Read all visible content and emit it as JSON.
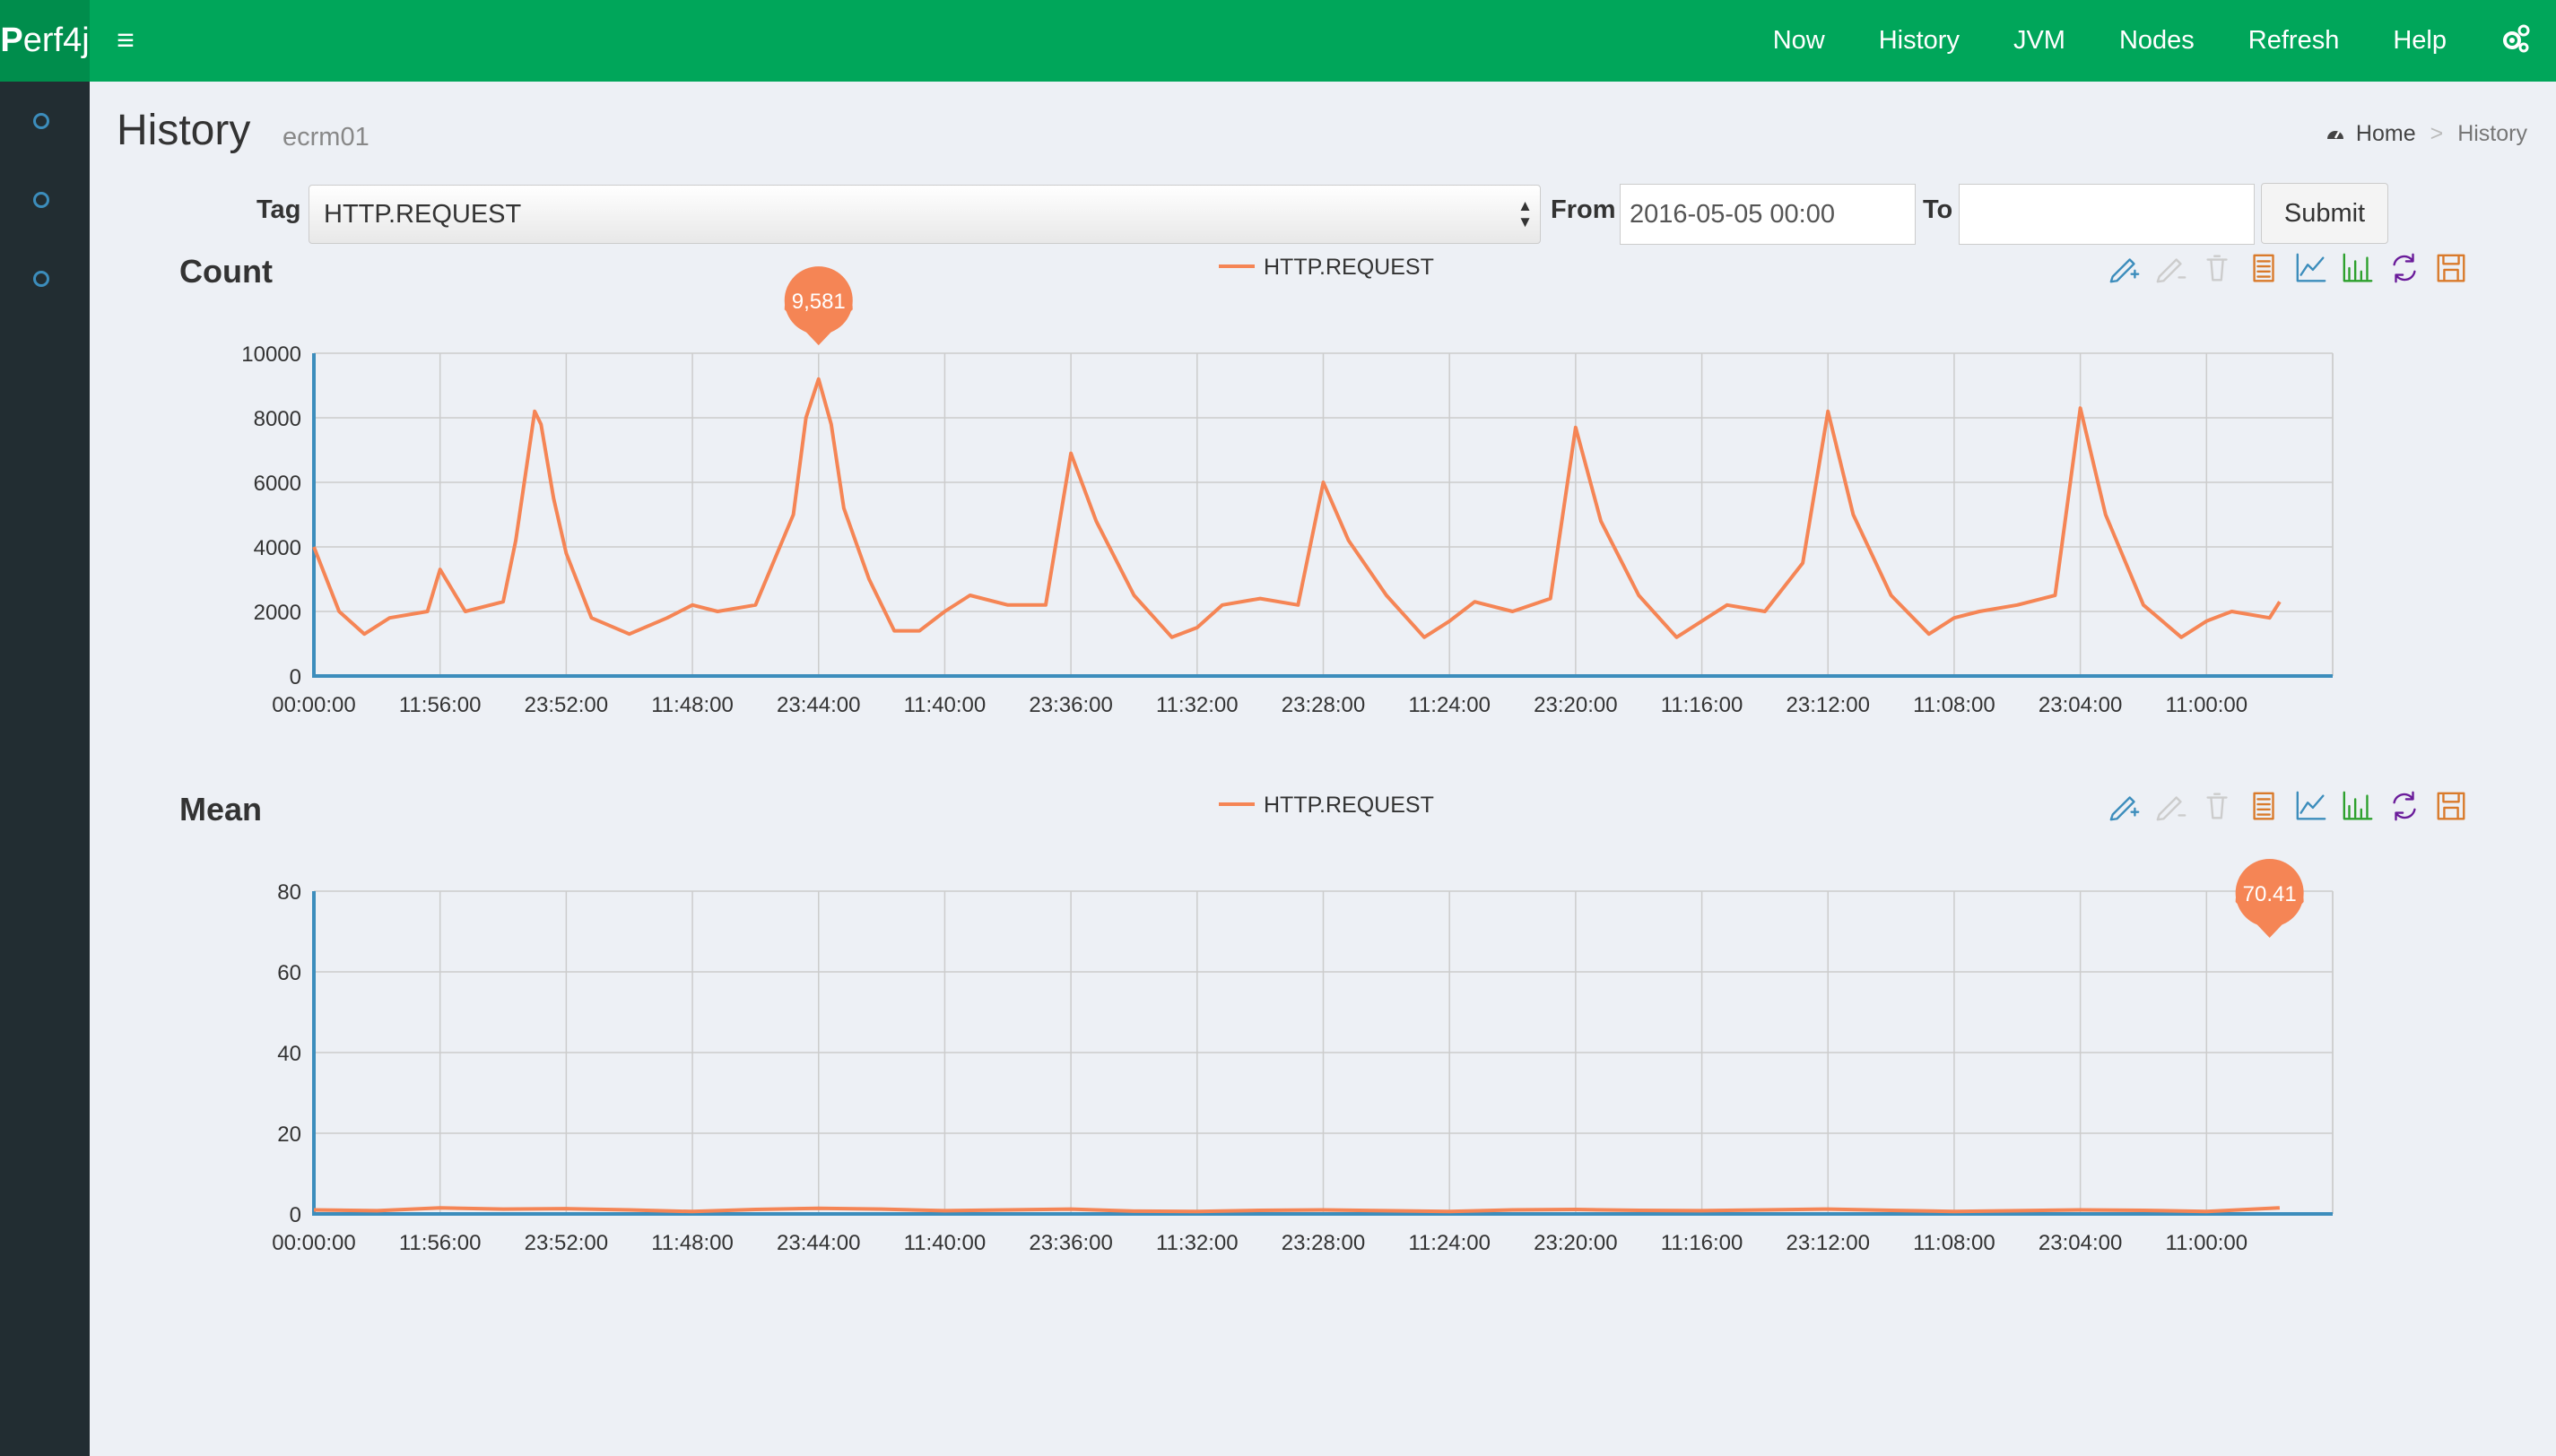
{
  "app": {
    "logo_first": "P",
    "logo_rest": "erf4j"
  },
  "topnav": [
    "Now",
    "History",
    "JVM",
    "Nodes",
    "Refresh",
    "Help"
  ],
  "icons": {
    "menu": "hamburger-icon",
    "settings": "gears-icon",
    "home": "dashboard-icon",
    "sidebar": [
      "circle-icon",
      "circle-icon",
      "circle-icon"
    ],
    "toolbox": [
      "mark-pen-icon",
      "mark-undo-icon",
      "mark-clear-icon",
      "data-view-icon",
      "line-chart-icon",
      "bar-chart-icon",
      "restore-icon",
      "save-image-icon"
    ]
  },
  "page": {
    "title": "History",
    "subtitle": "ecrm01"
  },
  "breadcrumb": {
    "home": "Home",
    "separator": ">",
    "current": "History"
  },
  "filters": {
    "tag_label": "Tag",
    "tag_value": "HTTP.REQUEST",
    "from_label": "From",
    "from_value": "2016-05-05 00:00",
    "to_label": "To",
    "to_value": "",
    "submit": "Submit"
  },
  "colors": {
    "header": "#00a65a",
    "sidebar": "#222d32",
    "series": "#f58555",
    "axis": "#3c8dbc"
  },
  "chart_data": [
    {
      "type": "line",
      "title": "Count",
      "legend": [
        "HTTP.REQUEST"
      ],
      "legend_position": "top-center",
      "grid": true,
      "x_tick_labels": [
        "00:00:00",
        "11:56:00",
        "23:52:00",
        "11:48:00",
        "23:44:00",
        "11:40:00",
        "23:36:00",
        "11:32:00",
        "23:28:00",
        "11:24:00",
        "23:20:00",
        "11:16:00",
        "23:12:00",
        "11:08:00",
        "23:04:00",
        "11:00:00"
      ],
      "ylim": [
        0,
        10000
      ],
      "y_ticks": [
        0,
        2000,
        4000,
        6000,
        8000,
        10000
      ],
      "max_marker": {
        "label": "9,581",
        "value": 9581,
        "x_index": 4
      },
      "series": [
        {
          "name": "HTTP.REQUEST",
          "x": [
            0,
            0.2,
            0.4,
            0.6,
            0.9,
            1.0,
            1.2,
            1.5,
            1.6,
            1.75,
            1.8,
            1.9,
            2.0,
            2.2,
            2.5,
            2.8,
            3.0,
            3.2,
            3.5,
            3.8,
            3.9,
            4.0,
            4.1,
            4.2,
            4.4,
            4.6,
            4.8,
            5.0,
            5.2,
            5.5,
            5.8,
            6.0,
            6.2,
            6.5,
            6.8,
            7.0,
            7.2,
            7.5,
            7.8,
            8.0,
            8.2,
            8.5,
            8.8,
            9.0,
            9.2,
            9.5,
            9.8,
            10.0,
            10.2,
            10.5,
            10.8,
            11.0,
            11.2,
            11.5,
            11.8,
            12.0,
            12.2,
            12.5,
            12.8,
            13.0,
            13.2,
            13.5,
            13.8,
            14.0,
            14.2,
            14.5,
            14.8,
            15.0,
            15.2,
            15.5,
            15.58
          ],
          "y": [
            4000,
            2000,
            1300,
            1800,
            2000,
            3300,
            2000,
            2300,
            4200,
            8200,
            7800,
            5500,
            3800,
            1800,
            1300,
            1800,
            2200,
            2000,
            2200,
            5000,
            8000,
            9200,
            7800,
            5200,
            3000,
            1400,
            1400,
            2000,
            2500,
            2200,
            2200,
            6900,
            4800,
            2500,
            1200,
            1500,
            2200,
            2400,
            2200,
            6000,
            4200,
            2500,
            1200,
            1700,
            2300,
            2000,
            2400,
            7700,
            4800,
            2500,
            1200,
            1700,
            2200,
            2000,
            3500,
            8200,
            5000,
            2500,
            1300,
            1800,
            2000,
            2200,
            2500,
            8300,
            5000,
            2200,
            1200,
            1700,
            2000,
            1800,
            2300
          ]
        }
      ]
    },
    {
      "type": "line",
      "title": "Mean",
      "legend": [
        "HTTP.REQUEST"
      ],
      "legend_position": "top-center",
      "grid": true,
      "x_tick_labels": [
        "00:00:00",
        "11:56:00",
        "23:52:00",
        "11:48:00",
        "23:44:00",
        "11:40:00",
        "23:36:00",
        "11:32:00",
        "23:28:00",
        "11:24:00",
        "23:20:00",
        "11:16:00",
        "23:12:00",
        "11:08:00",
        "23:04:00",
        "11:00:00"
      ],
      "ylim": [
        0,
        80
      ],
      "y_ticks": [
        0,
        20,
        40,
        60,
        80
      ],
      "max_marker": {
        "label": "70.41",
        "value": 70.41,
        "x_index": 15.5
      },
      "series": [
        {
          "name": "HTTP.REQUEST",
          "x": [
            0,
            0.5,
            1.0,
            1.5,
            2.0,
            2.5,
            3.0,
            3.5,
            4.0,
            4.5,
            5.0,
            5.5,
            6.0,
            6.5,
            7.0,
            7.5,
            8.0,
            8.5,
            9.0,
            9.5,
            10.0,
            10.5,
            11.0,
            11.5,
            12.0,
            12.5,
            13.0,
            13.5,
            14.0,
            14.5,
            15.0,
            15.58
          ],
          "y": [
            1.0,
            0.8,
            1.5,
            1.2,
            1.3,
            1.0,
            0.6,
            1.1,
            1.4,
            1.2,
            0.8,
            1.0,
            1.2,
            0.7,
            0.6,
            0.9,
            1.0,
            0.8,
            0.6,
            1.0,
            1.1,
            0.9,
            0.8,
            1.0,
            1.2,
            0.9,
            0.6,
            0.8,
            1.0,
            0.9,
            0.6,
            1.5
          ]
        }
      ]
    }
  ]
}
